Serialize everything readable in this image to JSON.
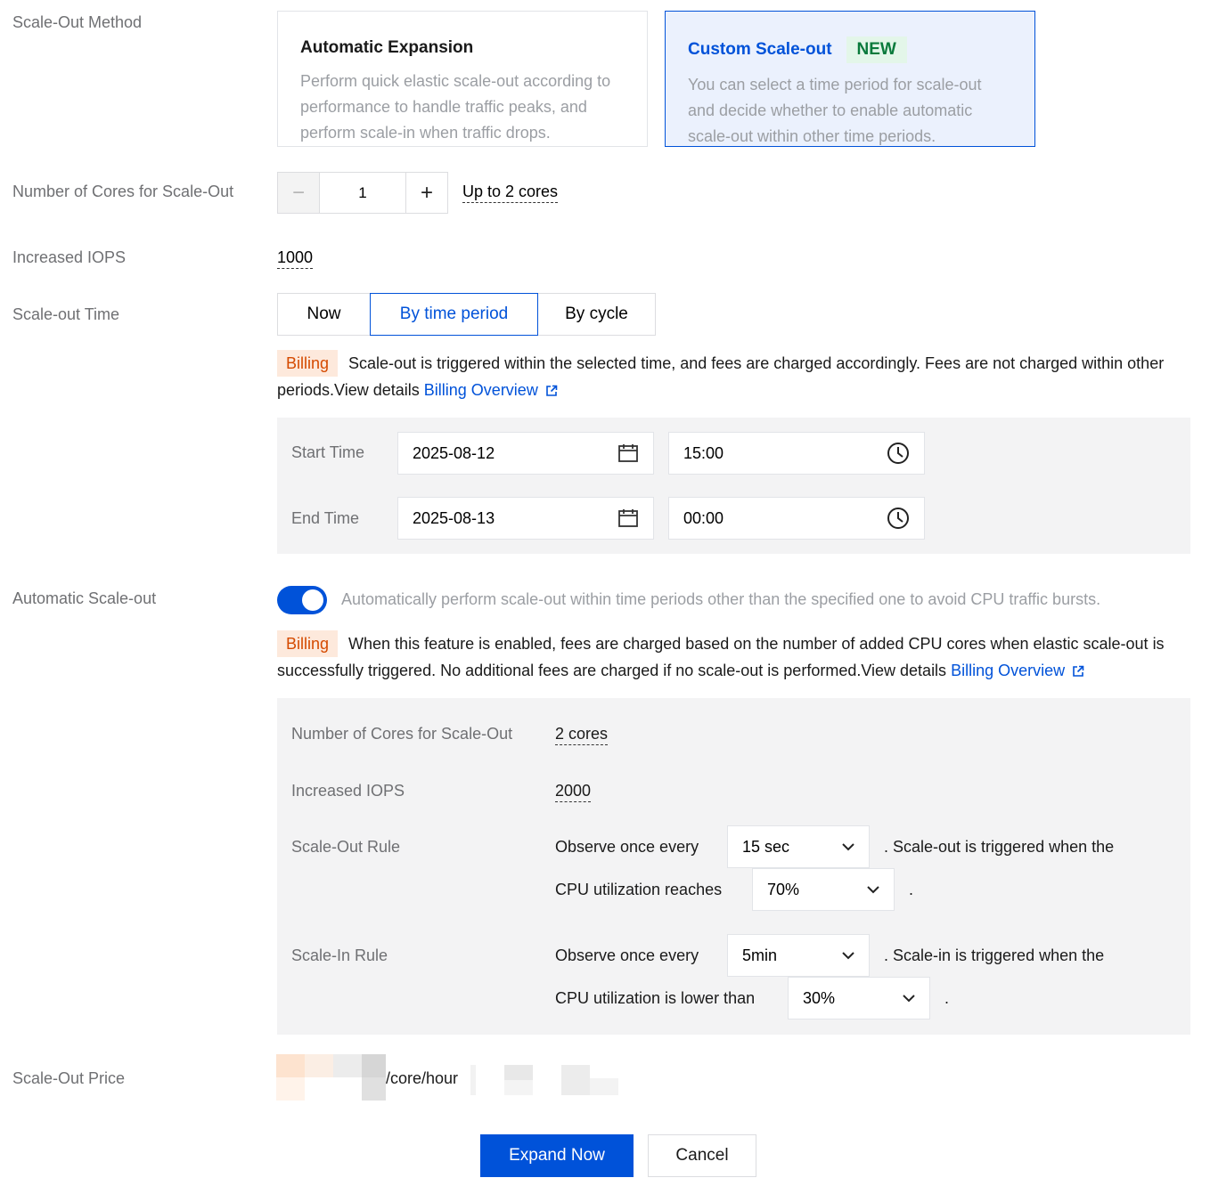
{
  "labels": {
    "method": "Scale-Out Method",
    "cores": "Number of Cores for Scale-Out",
    "iops": "Increased IOPS",
    "time": "Scale-out Time",
    "auto": "Automatic Scale-out",
    "price": "Scale-Out Price"
  },
  "method_cards": {
    "automatic": {
      "title": "Automatic Expansion",
      "desc": "Perform quick elastic scale-out according to performance to handle traffic peaks, and perform scale-in when traffic drops."
    },
    "custom": {
      "title": "Custom Scale-out",
      "badge": "NEW",
      "desc": "You can select a time period for scale-out and decide whether to enable automatic scale-out within other time periods."
    }
  },
  "cores": {
    "minus": "−",
    "value": "1",
    "plus": "+",
    "hint": "Up to 2 cores"
  },
  "iops": {
    "value": "1000"
  },
  "time_tabs": [
    "Now",
    "By time period",
    "By cycle"
  ],
  "time_active": "By time period",
  "billing1": {
    "tag": "Billing",
    "text": "Scale-out is triggered within the selected time, and fees are charged accordingly. Fees are not charged within other periods.View details",
    "link": "Billing Overview"
  },
  "period": {
    "start_label": "Start Time",
    "start_date": "2025-08-12",
    "start_time": "15:00",
    "end_label": "End Time",
    "end_date": "2025-08-13",
    "end_time": "00:00"
  },
  "auto": {
    "enabled": true,
    "desc": "Automatically perform scale-out within time periods other than the specified one to avoid CPU traffic bursts."
  },
  "billing2": {
    "tag": "Billing",
    "text": "When this feature is enabled, fees are charged based on the number of added CPU cores when elastic scale-out is successfully triggered. No additional fees are charged if no scale-out is performed.View details",
    "link": "Billing Overview"
  },
  "auto_panel": {
    "cores_label": "Number of Cores for Scale-Out",
    "cores_value": "2 cores",
    "iops_label": "Increased IOPS",
    "iops_value": "2000",
    "out_rule_label": "Scale-Out Rule",
    "out_observe": "Observe once every",
    "out_interval": "15 sec",
    "out_trigger": ". Scale-out is triggered when the",
    "out_cpu_text": "CPU utilization reaches",
    "out_cpu_value": "70%",
    "out_end": ".",
    "in_rule_label": "Scale-In Rule",
    "in_observe": "Observe once every",
    "in_interval": "5min",
    "in_trigger": ". Scale-in is triggered when the",
    "in_cpu_text": "CPU utilization is lower than",
    "in_cpu_value": "30%",
    "in_end": "."
  },
  "price": {
    "unit": "/core/hour"
  },
  "actions": {
    "expand": "Expand Now",
    "cancel": "Cancel"
  },
  "colors": {
    "accent": "#0052d9",
    "billing_bg": "#fde9dc",
    "billing_fg": "#d54a00",
    "new_bg": "#e3f6e9",
    "new_fg": "#0a7a3c"
  }
}
